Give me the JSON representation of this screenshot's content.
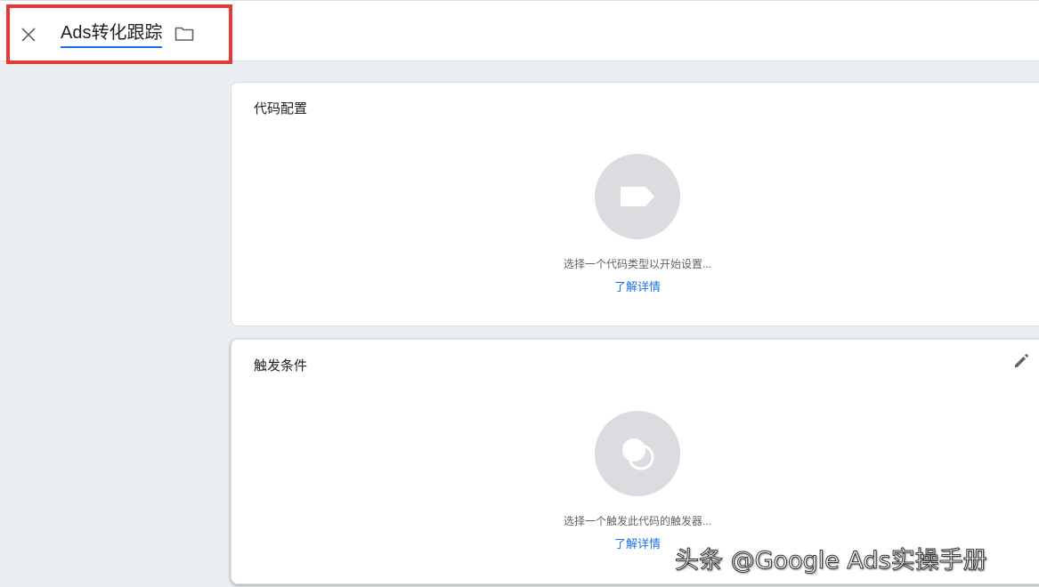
{
  "header": {
    "title": "Ads转化跟踪",
    "close_icon": "close-icon",
    "folder_icon": "folder-icon"
  },
  "tag_card": {
    "title": "代码配置",
    "icon": "tag-icon",
    "hint": "选择一个代码类型以开始设置...",
    "learn_more": "了解详情"
  },
  "trigger_card": {
    "title": "触发条件",
    "icon": "trigger-icon",
    "edit_icon": "pencil-icon",
    "hint": "选择一个触发此代码的触发器...",
    "learn_more": "了解详情"
  },
  "watermark": "头条 @Google Ads实操手册",
  "colors": {
    "accent": "#1a73e8",
    "highlight": "#e53935",
    "background": "#eceff1",
    "placeholder_circle": "#dadce0"
  }
}
